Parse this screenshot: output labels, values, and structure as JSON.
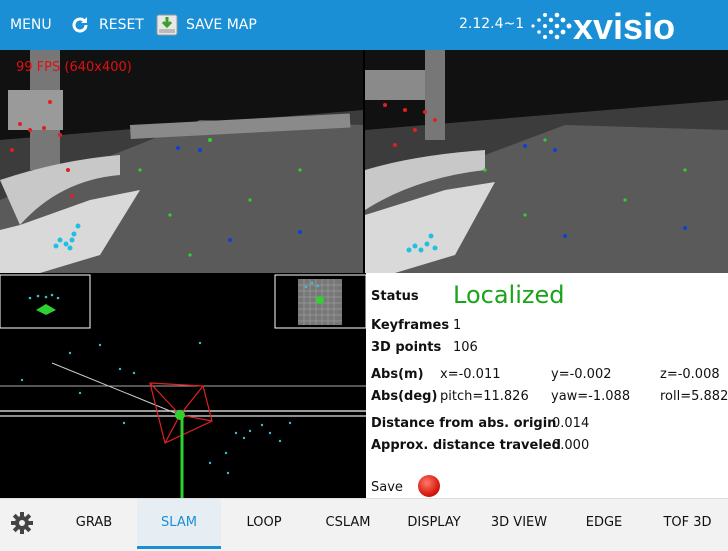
{
  "toolbar": {
    "menu_label": "MENU",
    "reset_label": "RESET",
    "save_map_label": "SAVE MAP",
    "version": "2.12.4~1",
    "logo_text": "xvisio"
  },
  "camera": {
    "fps_text": "99 FPS (640x400)"
  },
  "status": {
    "status_label": "Status",
    "status_value": "Localized",
    "keyframes_label": "Keyframes",
    "keyframes_value": "1",
    "points_label": "3D points",
    "points_value": "106",
    "abs_m_label": "Abs(m)",
    "x": "x=-0.011",
    "y": "y=-0.002",
    "z": "z=-0.008",
    "abs_deg_label": "Abs(deg)",
    "pitch": "pitch=11.826",
    "yaw": "yaw=-1.088",
    "roll": "roll=5.882",
    "dist_origin_label": "Distance from abs. origin",
    "dist_origin_value": "0.014",
    "dist_traveled_label": "Approx. distance traveled",
    "dist_traveled_value": "0.000",
    "save_label": "Save"
  },
  "tabs": [
    {
      "label": "GRAB"
    },
    {
      "label": "SLAM",
      "active": true
    },
    {
      "label": "LOOP"
    },
    {
      "label": "CSLAM"
    },
    {
      "label": "DISPLAY"
    },
    {
      "label": "3D VIEW"
    },
    {
      "label": "EDGE"
    },
    {
      "label": "TOF 3D"
    }
  ],
  "colors": {
    "accent": "#1a8fd6",
    "status_ok": "#1aa31a",
    "record": "#e01010"
  }
}
